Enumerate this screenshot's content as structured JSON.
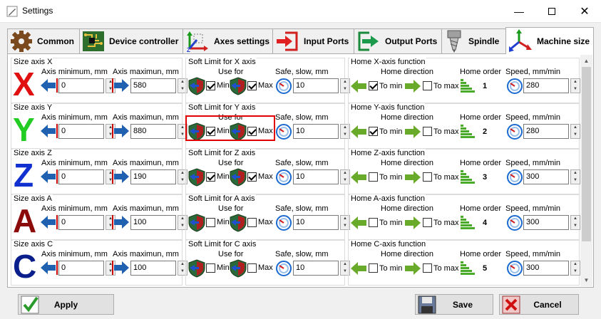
{
  "window": {
    "title": "Settings"
  },
  "tabs": [
    {
      "label": "Common",
      "icon": "gear-icon"
    },
    {
      "label": "Device controller",
      "icon": "circuit-board-icon"
    },
    {
      "label": "Axes settings",
      "icon": "axes-arrows-icon"
    },
    {
      "label": "Input Ports",
      "icon": "input-arrow-icon"
    },
    {
      "label": "Output Ports",
      "icon": "output-arrow-icon"
    },
    {
      "label": "Spindle",
      "icon": "spindle-icon"
    },
    {
      "label": "Machine size",
      "icon": "xyz-axes-icon"
    }
  ],
  "active_tab": "Machine size",
  "labels": {
    "axis_min": "Axis minimum, mm",
    "axis_max": "Axis maximun, mm",
    "use_for": "Use for",
    "safe_slow": "Safe, slow, mm",
    "min": "Min",
    "max": "Max",
    "home_direction": "Home direction",
    "home_order": "Home order",
    "speed": "Speed, mm/min",
    "to_min": "To min",
    "to_max": "To max"
  },
  "axes": [
    {
      "letter": "X",
      "color": "#e01010",
      "size_title": "Size axis X",
      "soft_title": "Soft Limit for X axis",
      "home_title": "Home X-axis function",
      "min": "0",
      "max": "580",
      "soft_min": true,
      "soft_max": true,
      "safe": "10",
      "to_min": true,
      "to_max": false,
      "order": "1",
      "speed": "280"
    },
    {
      "letter": "Y",
      "color": "#22cc22",
      "size_title": "Size axis Y",
      "soft_title": "Soft Limit for Y axis",
      "home_title": "Home Y-axis function",
      "min": "0",
      "max": "880",
      "soft_min": true,
      "soft_max": true,
      "safe": "10",
      "to_min": true,
      "to_max": false,
      "order": "2",
      "speed": "280"
    },
    {
      "letter": "Z",
      "color": "#1030d0",
      "size_title": "Size axis Z",
      "soft_title": "Soft Limit for Z axis",
      "home_title": "Home Z-axis function",
      "min": "0",
      "max": "190",
      "soft_min": true,
      "soft_max": true,
      "safe": "10",
      "to_min": false,
      "to_max": false,
      "order": "3",
      "speed": "300"
    },
    {
      "letter": "A",
      "color": "#8b0a0a",
      "size_title": "Size axis A",
      "soft_title": "Soft Limit for A axis",
      "home_title": "Home A-axis function",
      "min": "0",
      "max": "100",
      "soft_min": false,
      "soft_max": false,
      "safe": "10",
      "to_min": false,
      "to_max": false,
      "order": "4",
      "speed": "300"
    },
    {
      "letter": "C",
      "color": "#0a1f8b",
      "size_title": "Size axis C",
      "soft_title": "Soft Limit for C axis",
      "home_title": "Home C-axis function",
      "min": "0",
      "max": "100",
      "soft_min": false,
      "soft_max": false,
      "safe": "10",
      "to_min": false,
      "to_max": false,
      "order": "5",
      "speed": "300"
    }
  ],
  "buttons": {
    "apply": "Apply",
    "save": "Save",
    "cancel": "Cancel"
  }
}
